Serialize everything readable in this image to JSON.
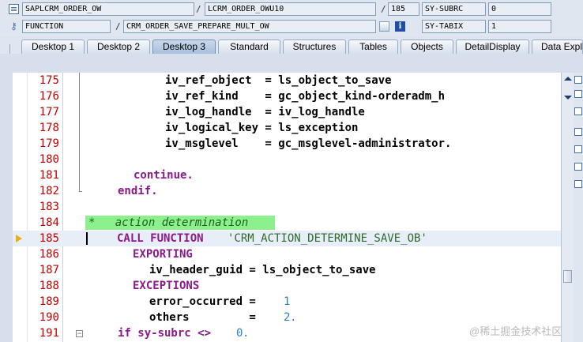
{
  "header": {
    "program": "SAPLCRM_ORDER_OW",
    "include": "LCRM_ORDER_OWU10",
    "line_no": "185",
    "var1_name": "SY-SUBRC",
    "var1_value": "0",
    "event_type": "FUNCTION",
    "event_name": "CRM_ORDER_SAVE_PREPARE_MULT_OW",
    "var2_name": "SY-TABIX",
    "var2_value": "1",
    "separator": "/"
  },
  "tabs": [
    {
      "label": "Desktop 1"
    },
    {
      "label": "Desktop 2"
    },
    {
      "label": "Desktop 3"
    },
    {
      "label": "Standard"
    },
    {
      "label": "Structures"
    },
    {
      "label": "Tables"
    },
    {
      "label": "Objects"
    },
    {
      "label": "DetailDisplay"
    },
    {
      "label": "Data Explo"
    }
  ],
  "active_tab": "Desktop 3",
  "code_lines": [
    {
      "num": "175",
      "a": "iv_ref_object  = ls_object_to_save"
    },
    {
      "num": "176",
      "a": "iv_ref_kind    = gc_object_kind-orderadm_h"
    },
    {
      "num": "177",
      "a": "iv_log_handle  = iv_log_handle"
    },
    {
      "num": "178",
      "a": "iv_logical_key = ls_exception"
    },
    {
      "num": "179",
      "a": "iv_msglevel    = gc_msglevel-administrator."
    },
    {
      "num": "180",
      "a": ""
    },
    {
      "num": "181",
      "a": "continue."
    },
    {
      "num": "182",
      "a": "endif."
    },
    {
      "num": "183",
      "a": ""
    },
    {
      "num": "184",
      "a": "*   action determination"
    },
    {
      "num": "185",
      "a": "CALL FUNCTION",
      "b": "'CRM_ACTION_DETERMINE_SAVE_OB'"
    },
    {
      "num": "186",
      "a": "EXPORTING"
    },
    {
      "num": "187",
      "a": "iv_header_guid = ls_object_to_save"
    },
    {
      "num": "188",
      "a": "EXCEPTIONS"
    },
    {
      "num": "189",
      "a": "error_occurred = ",
      "n": "1"
    },
    {
      "num": "190",
      "a": "others         = ",
      "n": "2",
      "c": "."
    },
    {
      "num": "191",
      "a": "if sy-subrc <> ",
      "n": "0",
      "c": "."
    }
  ],
  "watermark": "@稀土掘金技术社区",
  "colors": {
    "line_number": "#c00000",
    "keyword": "#8a1a8a",
    "string": "#2d6a2d",
    "number": "#2c7bd6",
    "comment_bg": "#8cf08c"
  }
}
